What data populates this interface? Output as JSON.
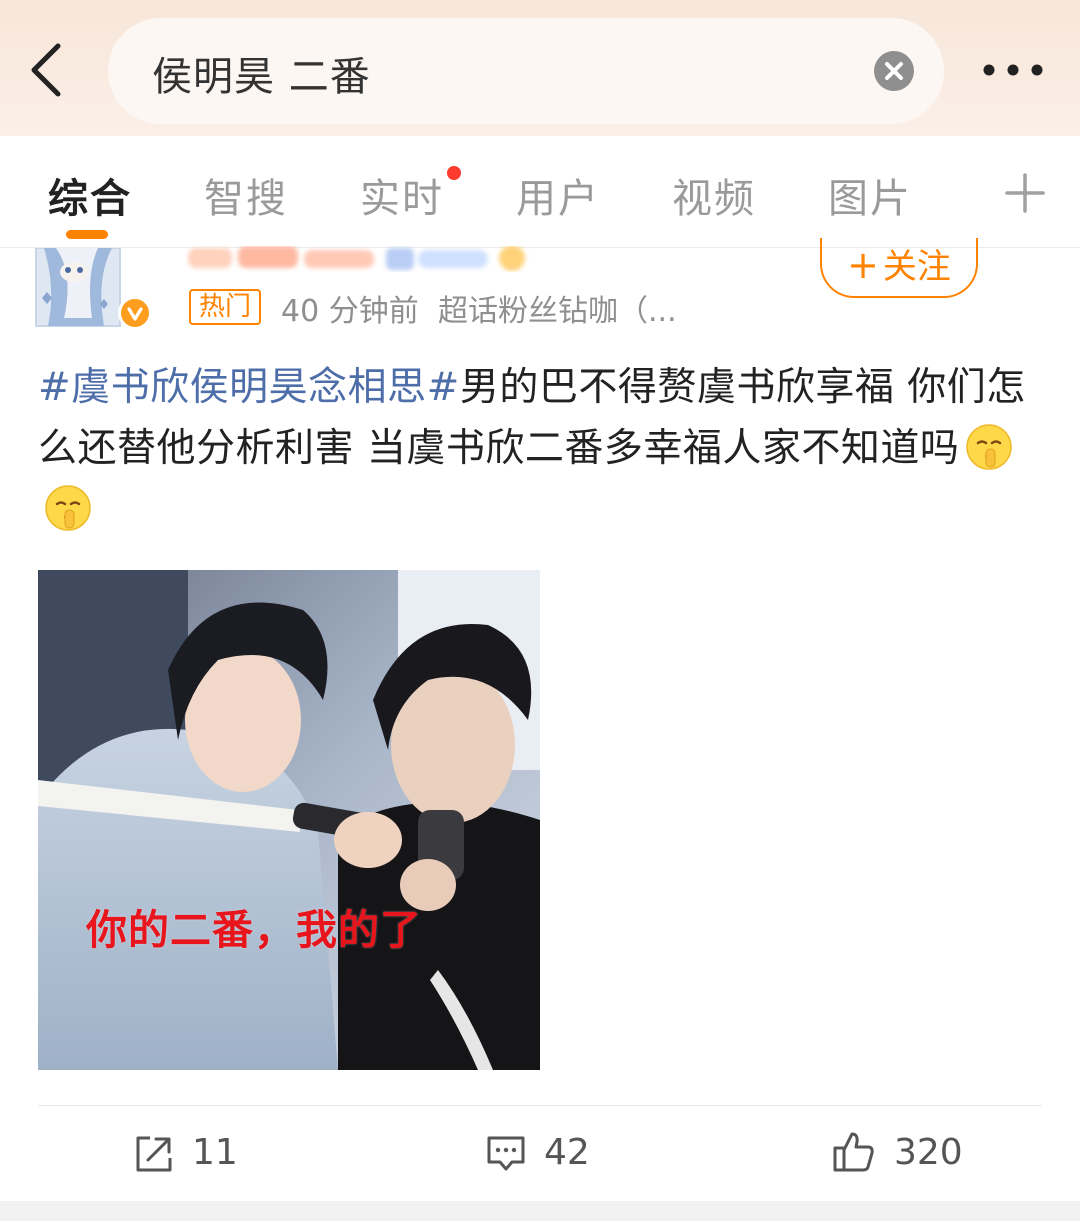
{
  "search": {
    "query": "侯明昊 二番"
  },
  "tabs": [
    {
      "label": "综合",
      "active": true
    },
    {
      "label": "智搜"
    },
    {
      "label": "实时",
      "has_dot": true
    },
    {
      "label": "用户"
    },
    {
      "label": "视频"
    },
    {
      "label": "图片"
    }
  ],
  "post": {
    "badge": "热门",
    "time": "40 分钟前",
    "source": "超话粉丝钻咖（...",
    "follow_label": "关注",
    "topic": "#虞书欣侯明昊念相思#",
    "body": "男的巴不得赘虞书欣享福 你们怎么还替他分析利害 当虞书欣二番多幸福人家不知道吗",
    "image_caption": "你的二番，我的了"
  },
  "actions": {
    "reposts": "11",
    "comments": "42",
    "likes": "320"
  },
  "colors": {
    "accent": "#ff8200",
    "topic_link": "#4e6eaa",
    "notification_dot": "#ff3b30"
  }
}
